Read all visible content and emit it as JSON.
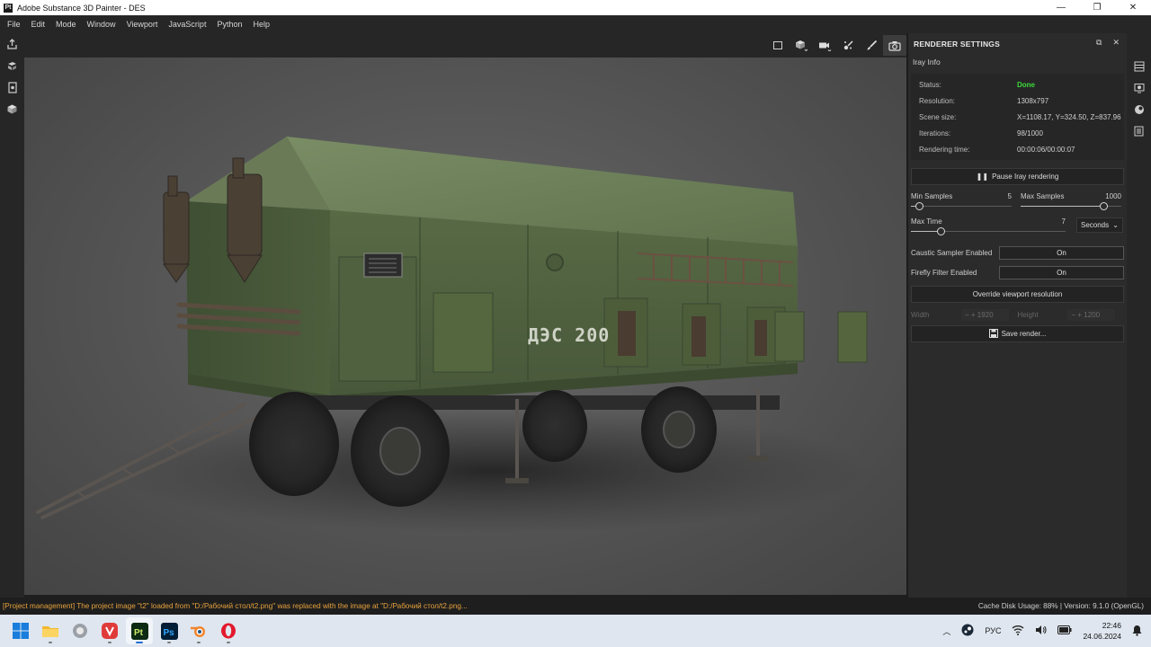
{
  "window": {
    "title": "Adobe Substance 3D Painter - DES",
    "app_badge": "Pt",
    "minimize": "—",
    "maximize": "❐",
    "close": "✕"
  },
  "menu": [
    "File",
    "Edit",
    "Mode",
    "Window",
    "Viewport",
    "JavaScript",
    "Python",
    "Help"
  ],
  "viewport": {
    "vehicle_marking": "ДЭС 200"
  },
  "renderer": {
    "panel_title": "RENDERER SETTINGS",
    "section": "Iray Info",
    "info": [
      {
        "key": "Status:",
        "value": "Done"
      },
      {
        "key": "Resolution:",
        "value": "1308x797"
      },
      {
        "key": "Scene size:",
        "value": "X=1108.17, Y=324.50, Z=837.96"
      },
      {
        "key": "Iterations:",
        "value": "98/1000"
      },
      {
        "key": "Rendering time:",
        "value": "00:00:06/00:00:07"
      }
    ],
    "pause_label": "Pause Iray rendering",
    "min_samples": {
      "label": "Min Samples",
      "value": "5",
      "fraction": 0.05
    },
    "max_samples": {
      "label": "Max Samples",
      "value": "1000",
      "fraction": 0.85
    },
    "max_time": {
      "label": "Max Time",
      "value": "7",
      "fraction": 0.18,
      "unit": "Seconds"
    },
    "caustic": {
      "label": "Caustic Sampler Enabled",
      "value": "On"
    },
    "firefly": {
      "label": "Firefly Filter Enabled",
      "value": "On"
    },
    "override_label": "Override viewport resolution",
    "width": {
      "label": "Width",
      "value": "1920"
    },
    "height": {
      "label": "Height",
      "value": "1200"
    },
    "save_label": "Save render..."
  },
  "status": {
    "message": "[Project management] The project image \"t2\" loaded from \"D:/Рабочий стол/t2.png\" was replaced with the image at \"D:/Рабочий стол/t2.png...",
    "cache": "Cache Disk Usage:   88% | Version: 9.1.0 (OpenGL)"
  },
  "taskbar": {
    "lang": "РУС",
    "time": "22:46",
    "date": "24.06.2024"
  }
}
